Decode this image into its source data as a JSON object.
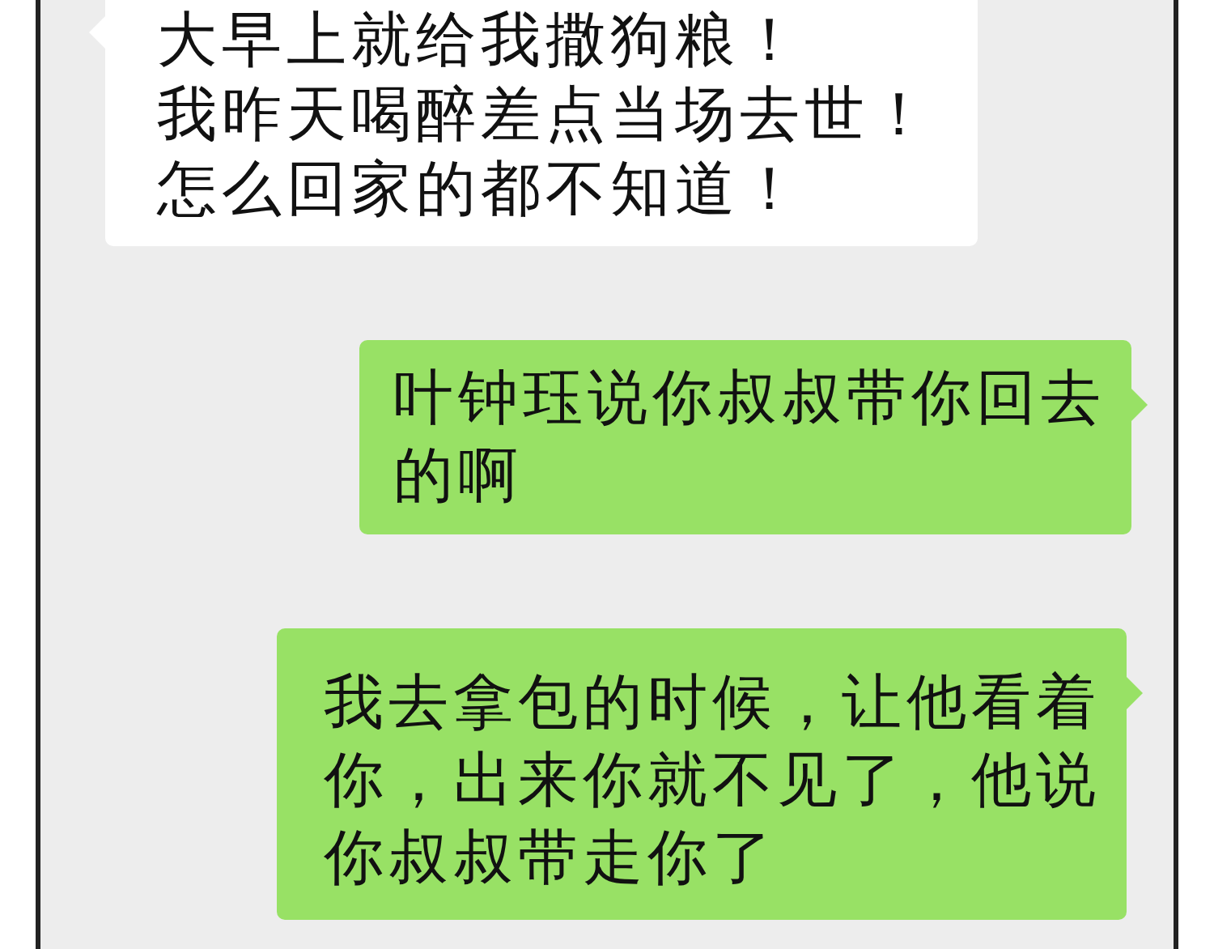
{
  "messages": [
    {
      "kind": "received",
      "lines": [
        "大早上就给我撒狗粮！",
        "我昨天喝醉差点当场去世！",
        "怎么回家的都不知道！"
      ]
    },
    {
      "kind": "sent",
      "text": "叶钟珏说你叔叔带你回去的啊"
    },
    {
      "kind": "sent",
      "text": "我去拿包的时候，让他看着你，出来你就不见了，他说你叔叔带走你了"
    }
  ]
}
